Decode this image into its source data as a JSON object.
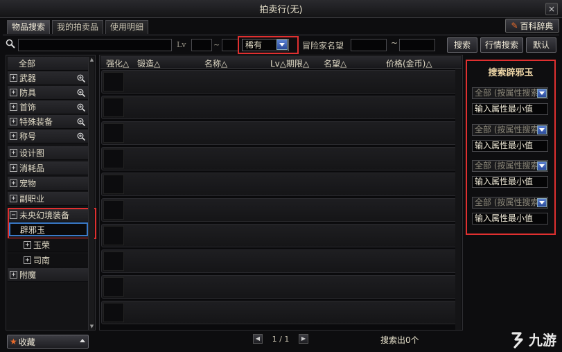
{
  "window": {
    "title": "拍卖行(无)",
    "close": "×"
  },
  "tabs": [
    {
      "label": "物品搜索",
      "active": true
    },
    {
      "label": "我的拍卖品",
      "active": false
    },
    {
      "label": "使用明细",
      "active": false
    }
  ],
  "dict_button": {
    "label": "百科辞典",
    "icon": "pen-icon"
  },
  "search": {
    "query": "",
    "lv_label": "Lv",
    "lv_sep": "~",
    "rarity_value": "稀有",
    "adventurer_label": "冒险家名望",
    "range_sep": "~",
    "buttons": {
      "search": "搜索",
      "market": "行情搜索",
      "default": "默认"
    }
  },
  "sidebar": {
    "items": [
      {
        "label": "全部",
        "expander": "",
        "zoom": false
      },
      {
        "label": "武器",
        "expander": "+",
        "zoom": true
      },
      {
        "label": "防具",
        "expander": "+",
        "zoom": true
      },
      {
        "label": "首饰",
        "expander": "+",
        "zoom": true
      },
      {
        "label": "特殊装备",
        "expander": "+",
        "zoom": true
      },
      {
        "label": "称号",
        "expander": "+",
        "zoom": true
      },
      {
        "label": "设计图",
        "expander": "+",
        "zoom": false
      },
      {
        "label": "消耗品",
        "expander": "+",
        "zoom": false
      },
      {
        "label": "宠物",
        "expander": "+",
        "zoom": false
      },
      {
        "label": "副职业",
        "expander": "+",
        "zoom": false
      },
      {
        "label": "未央幻境装备",
        "expander": "−",
        "zoom": false
      },
      {
        "label": "辟邪玉",
        "expander": "",
        "zoom": false
      },
      {
        "label": "玉荣",
        "expander": "+",
        "zoom": false
      },
      {
        "label": "司南",
        "expander": "+",
        "zoom": false
      },
      {
        "label": "附魔",
        "expander": "+",
        "zoom": false
      }
    ],
    "favorites": "收藏"
  },
  "results": {
    "columns": [
      "强化△",
      "锻造△",
      "名称△",
      "Lv△期限△",
      "名望△",
      "价格(金币)△"
    ],
    "row_count": 10,
    "pager": "1 / 1",
    "count_text": "搜索出0个"
  },
  "properties": {
    "title": "搜索辟邪玉",
    "filters": [
      {
        "select": "全部 (按属性搜索)",
        "input": "输入属性最小值"
      },
      {
        "select": "全部 (按属性搜索)",
        "input": "输入属性最小值"
      },
      {
        "select": "全部 (按属性搜索)",
        "input": "输入属性最小值"
      },
      {
        "select": "全部 (按属性搜索)",
        "input": "输入属性最小值"
      }
    ]
  },
  "watermark": {
    "text": "九游"
  },
  "colors": {
    "highlight": "#e03030",
    "selection": "#3a7ac8",
    "accent": "#e86a2a"
  }
}
